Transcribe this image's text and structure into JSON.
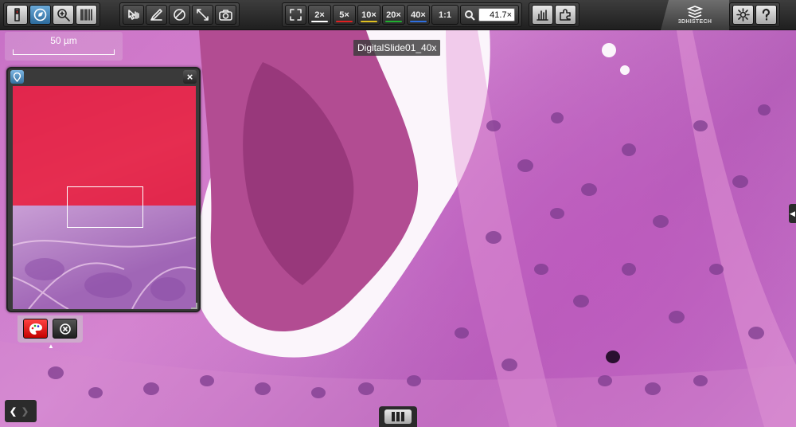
{
  "toolbar": {
    "tools": [
      {
        "id": "slide-tray",
        "icon": "slide-icon",
        "active": false
      },
      {
        "id": "navigate",
        "icon": "compass-icon",
        "active": true
      },
      {
        "id": "magnifier",
        "icon": "magnifier-icon",
        "active": false
      },
      {
        "id": "barcode",
        "icon": "barcode-icon",
        "active": false
      }
    ],
    "zoom_presets": [
      {
        "label": "2×",
        "color": "#ffffff"
      },
      {
        "label": "5×",
        "color": "#e02020"
      },
      {
        "label": "10×",
        "color": "#e0c020"
      },
      {
        "label": "20×",
        "color": "#20b030"
      },
      {
        "label": "40×",
        "color": "#2f6fe0"
      }
    ],
    "one_to_one_label": "1:1",
    "zoom_value": "41.7×",
    "brand": "3DHISTECH"
  },
  "viewer": {
    "slide_name": "DigitalSlide01_40x",
    "scale_bar_label": "50 µm"
  },
  "overview": {
    "region_overlay_color": "#eb1432"
  }
}
